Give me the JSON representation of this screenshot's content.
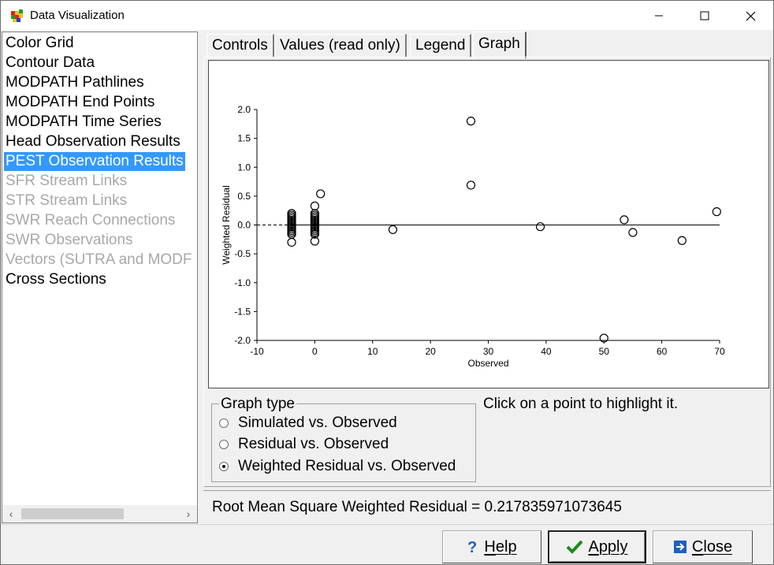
{
  "window": {
    "title": "Data Visualization"
  },
  "left_list": {
    "items": [
      {
        "label": "Color Grid",
        "state": "enabled"
      },
      {
        "label": "Contour Data",
        "state": "enabled"
      },
      {
        "label": "MODPATH Pathlines",
        "state": "enabled"
      },
      {
        "label": "MODPATH End Points",
        "state": "enabled"
      },
      {
        "label": "MODPATH Time Series",
        "state": "enabled"
      },
      {
        "label": "Head Observation Results",
        "state": "enabled"
      },
      {
        "label": "PEST Observation Results",
        "state": "selected"
      },
      {
        "label": "SFR Stream Links",
        "state": "disabled"
      },
      {
        "label": "STR Stream Links",
        "state": "disabled"
      },
      {
        "label": "SWR Reach Connections",
        "state": "disabled"
      },
      {
        "label": "SWR Observations",
        "state": "disabled"
      },
      {
        "label": "Vectors (SUTRA and MODF",
        "state": "disabled"
      },
      {
        "label": "Cross Sections",
        "state": "enabled"
      }
    ]
  },
  "tabs": [
    {
      "label": "Controls"
    },
    {
      "label": "Values (read only)"
    },
    {
      "label": "Legend"
    },
    {
      "label": "Graph"
    }
  ],
  "active_tab": "Graph",
  "graph_type": {
    "legend": "Graph type",
    "options": [
      "Simulated vs. Observed",
      "Residual vs. Observed",
      "Weighted Residual vs. Observed"
    ],
    "selected_index": 2
  },
  "hint": "Click on a point to highlight it.",
  "rms_text": "Root Mean Square Weighted Residual = 0.217835971073645",
  "buttons": {
    "help": "Help",
    "apply": "Apply",
    "close": "Close"
  },
  "colors": {
    "selection": "#3399ff",
    "disabled_text": "#a8a8a8",
    "apply_check": "#1a8c1a",
    "close_icon": "#1f5fbf",
    "help_icon": "#1f5fbf"
  },
  "chart_data": {
    "type": "scatter",
    "title": "",
    "xlabel": "Observed",
    "ylabel": "Weighted Residual",
    "xlim": [
      -10,
      70
    ],
    "ylim": [
      -2.0,
      2.0
    ],
    "xticks": [
      "-10",
      "0",
      "10",
      "20",
      "30",
      "40",
      "50",
      "60",
      "70"
    ],
    "yticks": [
      "2.0",
      "1.5",
      "1.0",
      "0.5",
      "0.0",
      "-0.5",
      "-1.0",
      "-1.5",
      "-2.0"
    ],
    "x_tick_values": [
      -10,
      0,
      10,
      20,
      30,
      40,
      50,
      60,
      70
    ],
    "y_tick_values": [
      2.0,
      1.5,
      1.0,
      0.5,
      0.0,
      -0.5,
      -1.0,
      -1.5,
      -2.0
    ],
    "zero_line": {
      "dashed_segment": [
        -10,
        -4
      ],
      "solid_segment": [
        -4,
        70
      ]
    },
    "points": [
      {
        "x": -4.0,
        "y": 0.2
      },
      {
        "x": -4.0,
        "y": 0.17
      },
      {
        "x": -4.0,
        "y": 0.14
      },
      {
        "x": -4.0,
        "y": 0.11
      },
      {
        "x": -4.0,
        "y": 0.08
      },
      {
        "x": -4.0,
        "y": 0.05
      },
      {
        "x": -4.0,
        "y": 0.02
      },
      {
        "x": -4.0,
        "y": -0.01
      },
      {
        "x": -4.0,
        "y": -0.04
      },
      {
        "x": -4.0,
        "y": -0.07
      },
      {
        "x": -4.0,
        "y": -0.1
      },
      {
        "x": -4.0,
        "y": -0.13
      },
      {
        "x": -4.0,
        "y": -0.16
      },
      {
        "x": -4.0,
        "y": -0.3
      },
      {
        "x": 0.0,
        "y": 0.33
      },
      {
        "x": 0.0,
        "y": 0.2
      },
      {
        "x": 0.0,
        "y": 0.17
      },
      {
        "x": 0.0,
        "y": 0.14
      },
      {
        "x": 0.0,
        "y": 0.11
      },
      {
        "x": 0.0,
        "y": 0.08
      },
      {
        "x": 0.0,
        "y": 0.05
      },
      {
        "x": 0.0,
        "y": 0.02
      },
      {
        "x": 0.0,
        "y": -0.01
      },
      {
        "x": 0.0,
        "y": -0.04
      },
      {
        "x": 0.0,
        "y": -0.07
      },
      {
        "x": 0.0,
        "y": -0.1
      },
      {
        "x": 0.0,
        "y": -0.13
      },
      {
        "x": 0.0,
        "y": -0.16
      },
      {
        "x": 0.0,
        "y": -0.28
      },
      {
        "x": 1.0,
        "y": 0.54
      },
      {
        "x": 13.5,
        "y": -0.08
      },
      {
        "x": 27.0,
        "y": 1.8
      },
      {
        "x": 27.0,
        "y": 0.69
      },
      {
        "x": 39.0,
        "y": -0.03
      },
      {
        "x": 50.0,
        "y": -1.96
      },
      {
        "x": 53.5,
        "y": 0.09
      },
      {
        "x": 55.0,
        "y": -0.13
      },
      {
        "x": 63.5,
        "y": -0.27
      },
      {
        "x": 69.5,
        "y": 0.23
      }
    ]
  }
}
